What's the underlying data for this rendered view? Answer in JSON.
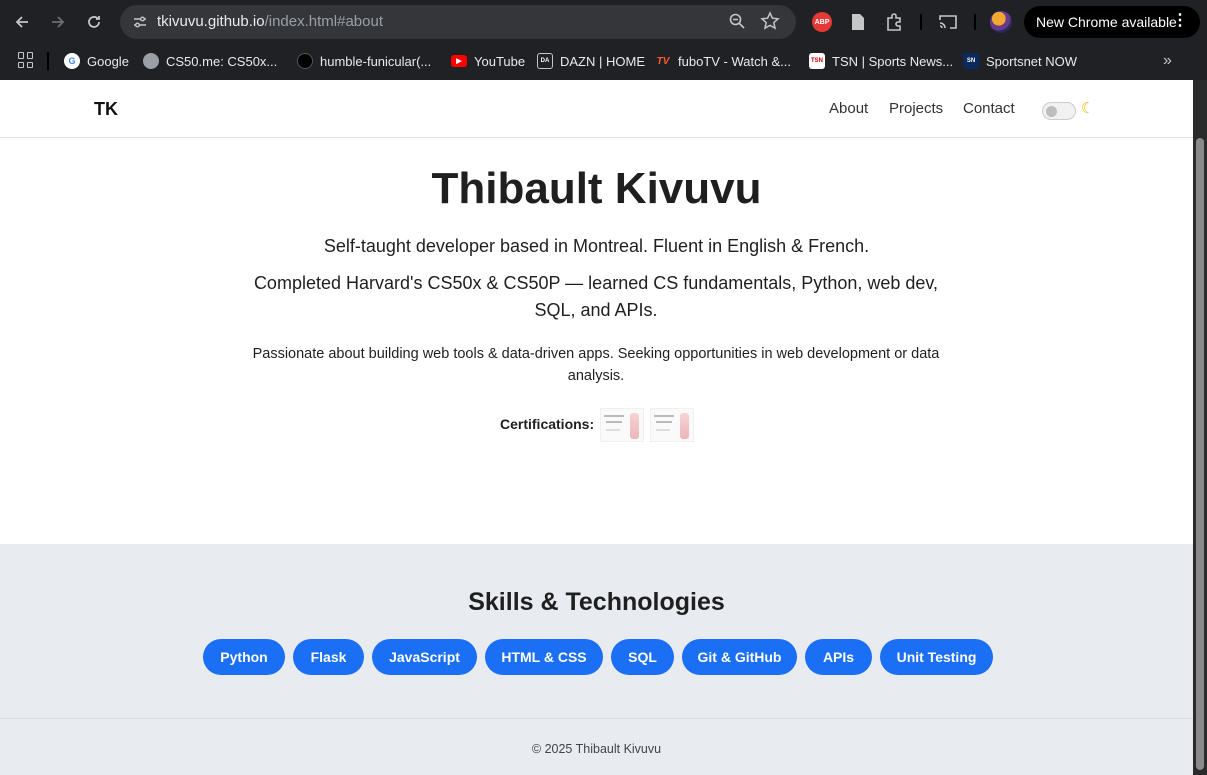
{
  "browser": {
    "url_host": "tkivuvu.github.io",
    "url_path": "/index.html#about",
    "update_label": "New Chrome available",
    "abp_label": "ABP",
    "bookmarks": [
      {
        "label": "Google",
        "icon": "google-icon",
        "color": "#ffffff"
      },
      {
        "label": "CS50.me: CS50x...",
        "icon": "globe-icon",
        "color": "#9aa0a6"
      },
      {
        "label": "humble-funicular(...",
        "icon": "github-icon",
        "color": "#202124"
      },
      {
        "label": "YouTube",
        "icon": "youtube-icon",
        "color": "#ff0000"
      },
      {
        "label": "DAZN | HOME",
        "icon": "dazn-icon",
        "color": "#202124"
      },
      {
        "label": "fuboTV - Watch &...",
        "icon": "fubo-icon",
        "color": "#202124"
      },
      {
        "label": "TSN | Sports News...",
        "icon": "tsn-icon",
        "color": "#ffffff"
      },
      {
        "label": "Sportsnet NOW",
        "icon": "sportsnet-icon",
        "color": "#0b2a5b"
      }
    ]
  },
  "site": {
    "logo": "TK",
    "nav": [
      "About",
      "Projects",
      "Contact"
    ],
    "hero": {
      "name": "Thibault Kivuvu",
      "line1": "Self-taught developer based in Montreal. Fluent in English & French.",
      "line2": "Completed Harvard's CS50x & CS50P — learned CS fundamentals, Python, web dev, SQL, and APIs.",
      "line3": "Passionate about building web tools & data-driven apps. Seeking opportunities in web development or data analysis."
    },
    "certifications_label": "Certifications:",
    "skills_title": "Skills & Technologies",
    "skills": [
      "Python",
      "Flask",
      "JavaScript",
      "HTML & CSS",
      "SQL",
      "Git & GitHub",
      "APIs",
      "Unit Testing"
    ],
    "footer": "© 2025 Thibault Kivuvu"
  },
  "colors": {
    "accent": "#1a6ff5",
    "skills_bg": "#e8ebef"
  }
}
